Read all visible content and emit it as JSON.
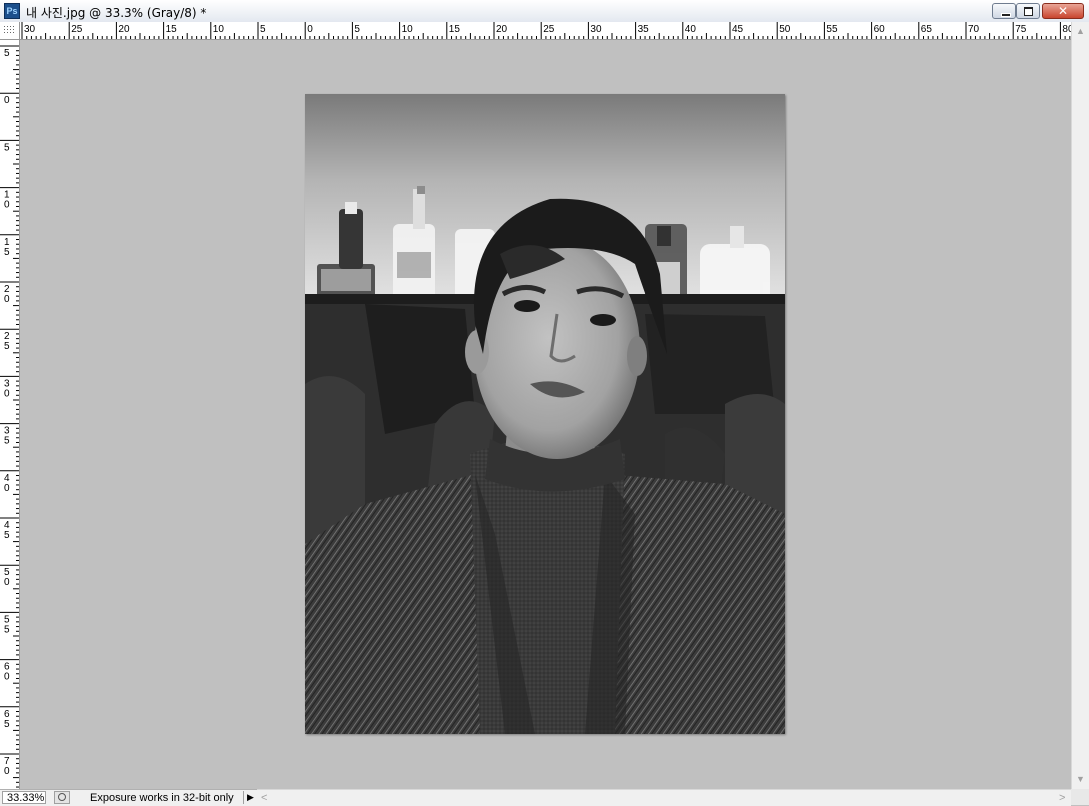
{
  "window": {
    "title": "내 사진.jpg @ 33.3% (Gray/8) *",
    "app_icon": "Ps",
    "minimize_icon": "minimize-icon",
    "maximize_icon": "restore-icon",
    "close_glyph": "✕"
  },
  "rulers": {
    "horizontal_labels": [
      "30",
      "25",
      "20",
      "15",
      "10",
      "5",
      "0",
      "5",
      "10",
      "15",
      "20",
      "25",
      "30",
      "35",
      "40",
      "45",
      "50",
      "55",
      "60",
      "65",
      "70",
      "75",
      "80"
    ],
    "vertical_labels": [
      "5",
      "0",
      "5",
      "10",
      "15",
      "20",
      "25",
      "30",
      "35",
      "40",
      "45",
      "50",
      "55",
      "60",
      "65",
      "70"
    ]
  },
  "document": {
    "color_mode": "Gray/8",
    "zoom": "33.3%",
    "image_description_icon": "portrait-photo"
  },
  "statusbar": {
    "zoom_value": "33.33%",
    "info_text": "Exposure works in 32-bit only",
    "menu_arrow": "▶"
  },
  "scrollbars": {
    "up_arrow": "▲",
    "down_arrow": "▼",
    "left_arrow": "<",
    "right_arrow": ">"
  },
  "colors": {
    "canvas_background": "#c0c0c0",
    "close_button": "#c9452e"
  }
}
